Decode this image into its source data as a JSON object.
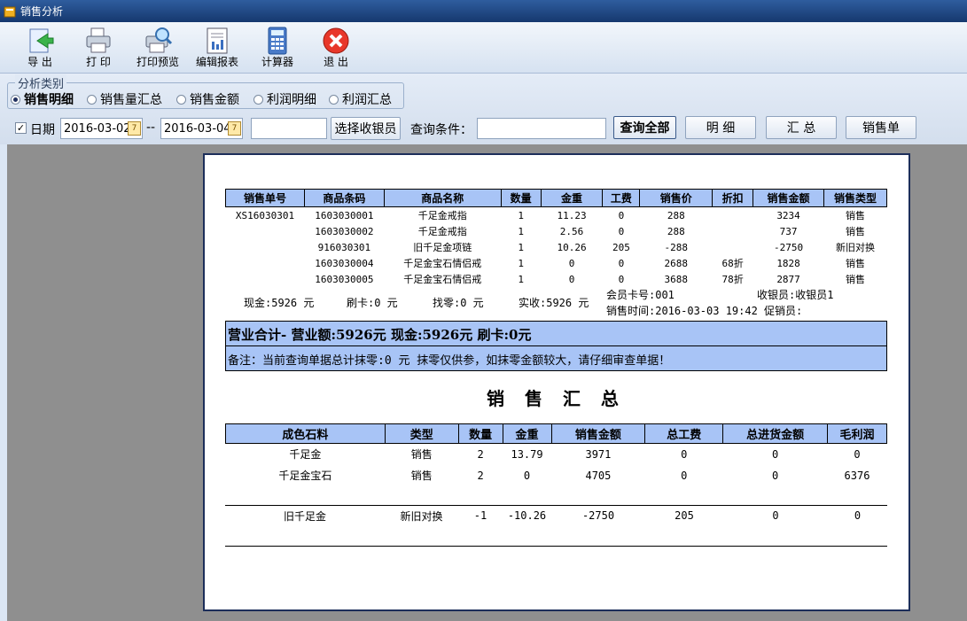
{
  "window": {
    "title": "销售分析"
  },
  "toolbar": [
    {
      "label": "导 出",
      "icon": "export-icon"
    },
    {
      "label": "打 印",
      "icon": "printer-icon"
    },
    {
      "label": "打印预览",
      "icon": "print-preview-icon"
    },
    {
      "label": "编辑报表",
      "icon": "report-edit-icon"
    },
    {
      "label": "计算器",
      "icon": "calculator-icon"
    },
    {
      "label": "退 出",
      "icon": "exit-icon"
    }
  ],
  "analysis": {
    "legend": "分析类别",
    "options": [
      "销售明细",
      "销售量汇总",
      "销售金额",
      "利润明细",
      "利润汇总"
    ],
    "selected": "销售明细"
  },
  "filters": {
    "date_label": "日期",
    "date_checked": true,
    "date_from": "2016-03-02",
    "date_sep": "--",
    "date_to": "2016-03-04",
    "cashier_value": "",
    "choose_cashier": "选择收银员",
    "query_label": "查询条件：",
    "query_value": "",
    "buttons": {
      "query_all": "查询全部",
      "detail": "明 细",
      "summary": "汇 总",
      "sales_slip": "销售单"
    }
  },
  "detail_table": {
    "headers": [
      "销售单号",
      "商品条码",
      "商品名称",
      "数量",
      "金重",
      "工费",
      "销售价",
      "折扣",
      "销售金额",
      "销售类型"
    ],
    "rows": [
      [
        "XS16030301",
        "1603030001",
        "千足金戒指",
        "1",
        "11.23",
        "0",
        "288",
        "",
        "3234",
        "销售"
      ],
      [
        "",
        "1603030002",
        "千足金戒指",
        "1",
        "2.56",
        "0",
        "288",
        "",
        "737",
        "销售"
      ],
      [
        "",
        "916030301",
        "旧千足金项链",
        "1",
        "10.26",
        "205",
        "-288",
        "",
        "-2750",
        "新旧对换"
      ],
      [
        "",
        "1603030004",
        "千足金宝石情侣戒",
        "1",
        "0",
        "0",
        "2688",
        "68折",
        "1828",
        "销售"
      ],
      [
        "",
        "1603030005",
        "千足金宝石情侣戒",
        "1",
        "0",
        "0",
        "3688",
        "78折",
        "2877",
        "销售"
      ]
    ]
  },
  "payment": {
    "cash": "现金:5926 元",
    "card": "刷卡:0 元",
    "change": "找零:0 元",
    "received": "实收:5926 元",
    "member": "会员卡号:001",
    "cashier": "收银员:收银员1",
    "sale_time": "销售时间:2016-03-03 19:42 促销员:"
  },
  "totals": {
    "line": "营业合计- 营业额:5926元  现金:5926元  刷卡:0元",
    "note": "备注：当前查询单据总计抹零:0 元 抹零仅供参，如抹零金额较大，请仔细审查单据！"
  },
  "summary_section": {
    "title": "销 售 汇 总",
    "headers": [
      "成色石料",
      "类型",
      "数量",
      "金重",
      "销售金额",
      "总工费",
      "总进货金额",
      "毛利润"
    ],
    "rows": [
      [
        "千足金",
        "销售",
        "2",
        "13.79",
        "3971",
        "0",
        "0",
        "0"
      ],
      [
        "千足金宝石",
        "销售",
        "2",
        "0",
        "4705",
        "0",
        "0",
        "6376"
      ]
    ],
    "exchange_rows": [
      [
        "旧千足金",
        "新旧对换",
        "-1",
        "-10.26",
        "-2750",
        "205",
        "0",
        "0"
      ]
    ]
  }
}
